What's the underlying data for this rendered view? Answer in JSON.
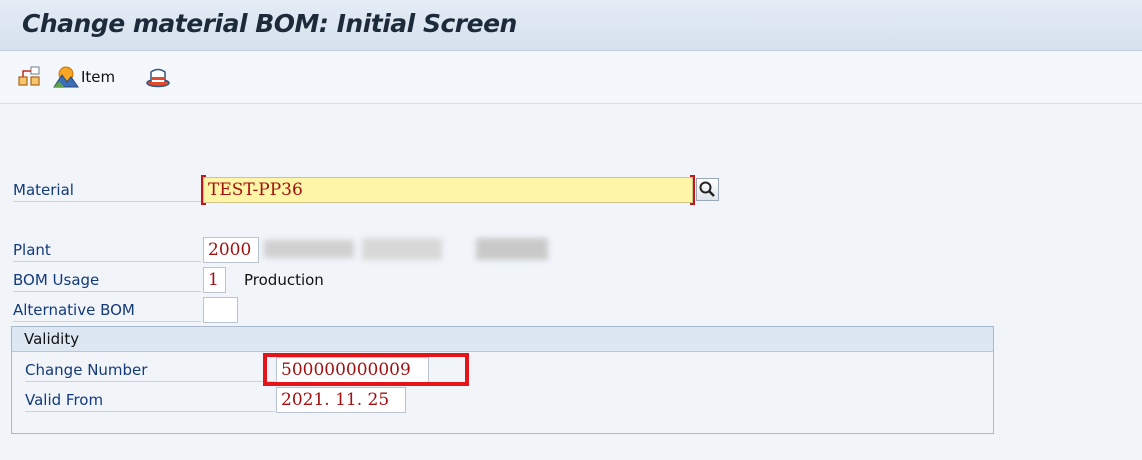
{
  "title": "Change material BOM: Initial Screen",
  "toolbar": {
    "icons": [
      "hierarchy-icon",
      "item-mountains-icon",
      "hat-icon"
    ],
    "item_label": "Item"
  },
  "fields": {
    "material": {
      "label": "Material",
      "value": "TEST-PP36"
    },
    "plant": {
      "label": "Plant",
      "value": "2000"
    },
    "bom_usage": {
      "label": "BOM Usage",
      "value": "1",
      "description": "Production"
    },
    "alternative_bom": {
      "label": "Alternative BOM",
      "value": ""
    }
  },
  "validity": {
    "heading": "Validity",
    "change_number": {
      "label": "Change Number",
      "value": "500000000009"
    },
    "valid_from": {
      "label": "Valid From",
      "value": "2021. 11. 25"
    }
  },
  "colors": {
    "field_value": "#a31010",
    "label": "#143a7a",
    "required_bg": "#fff5a6",
    "highlight": "#e3151b"
  }
}
